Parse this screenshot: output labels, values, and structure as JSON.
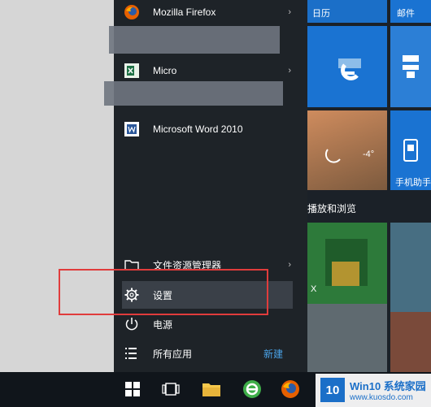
{
  "start_menu": {
    "recent_apps": [
      {
        "label": "Mozilla Firefox",
        "icon": "firefox-icon"
      },
      {
        "label": "Micro",
        "icon": "excel-icon"
      },
      {
        "label": "Microsoft Word 2010",
        "icon": "word-icon"
      }
    ],
    "bottom_items": {
      "file_explorer": "文件资源管理器",
      "settings": "设置",
      "power": "电源",
      "all_apps": "所有应用",
      "new_badge": "新建"
    }
  },
  "tiles": {
    "calendar": "日历",
    "mail": "邮件",
    "weather_temp": "-4°",
    "phone": "手机助手",
    "section_header": "播放和浏览",
    "tile_x": "X"
  },
  "taskbar": {
    "items": [
      "windows-start-icon",
      "task-view-icon",
      "file-explorer-icon",
      "ie360-icon",
      "firefox-icon"
    ]
  },
  "watermark": {
    "brand": "Win10 系统家园",
    "url": "www.kuosdo.com",
    "logo": "10"
  },
  "colors": {
    "highlight_box": "#e03c3c",
    "accent_blue": "#1a73d2",
    "link": "#4aa3e8"
  }
}
